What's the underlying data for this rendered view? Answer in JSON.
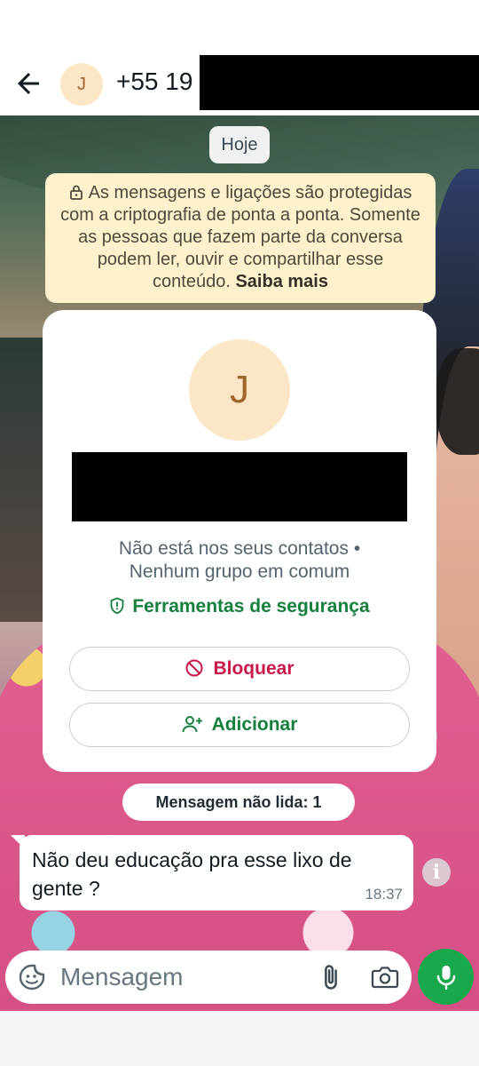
{
  "header": {
    "avatar_initial": "J",
    "contact_name": "+55 19"
  },
  "chat": {
    "date_chip": "Hoje",
    "encryption_notice": "As mensagens e ligações são protegidas com a criptografia de ponta a ponta. Somente as pessoas que fazem parte da conversa podem ler, ouvir e compartilhar esse conteúdo.",
    "encryption_link": "Saiba mais",
    "contact_card": {
      "avatar_initial": "J",
      "status_line_1": "Não está nos seus contatos •",
      "status_line_2": "Nenhum grupo em comum",
      "safety_tools_label": "Ferramentas de segurança",
      "block_label": "Bloquear",
      "add_label": "Adicionar"
    },
    "unread_chip": "Mensagem não lida: 1",
    "message": {
      "text": "Não deu educação pra esse lixo de gente ?",
      "time": "18:37"
    }
  },
  "input_bar": {
    "placeholder": "Mensagem"
  },
  "colors": {
    "accent_green": "#15803d",
    "mic_green": "#1aa84d",
    "block_red": "#c9184a",
    "avatar_bg": "#fbe7c6",
    "notice_bg": "#fff1cc"
  },
  "icons": {
    "back": "arrow-left-icon",
    "lock": "lock-icon",
    "shield": "shield-icon",
    "block": "block-icon",
    "add_contact": "add-person-icon",
    "info": "info-icon",
    "emoji": "sticker-icon",
    "attach": "paperclip-icon",
    "camera": "camera-icon",
    "mic": "microphone-icon"
  }
}
